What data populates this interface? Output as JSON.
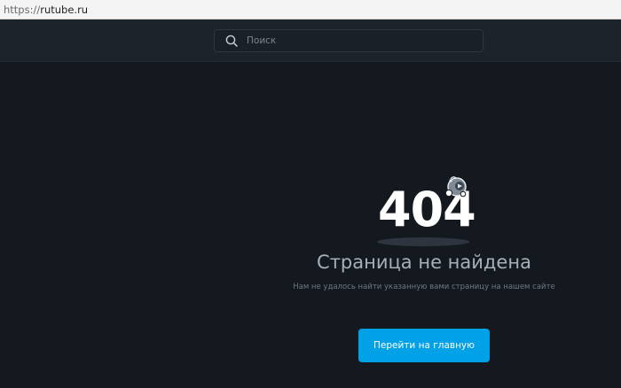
{
  "browser": {
    "url_scheme": "https://",
    "url_host": "rutube.ru"
  },
  "header": {
    "search": {
      "placeholder": "Поиск",
      "value": "",
      "icon": "search-icon"
    }
  },
  "error": {
    "code": "404",
    "title": "Страница не найдена",
    "subtitle": "Нам не удалось найти указанную вами страницу на нашем сайте",
    "illustration": "mascot-icon"
  },
  "actions": {
    "home_label": "Перейти на главную"
  },
  "colors": {
    "background": "#14191f",
    "header": "#1c232b",
    "accent": "#00a1e7"
  }
}
